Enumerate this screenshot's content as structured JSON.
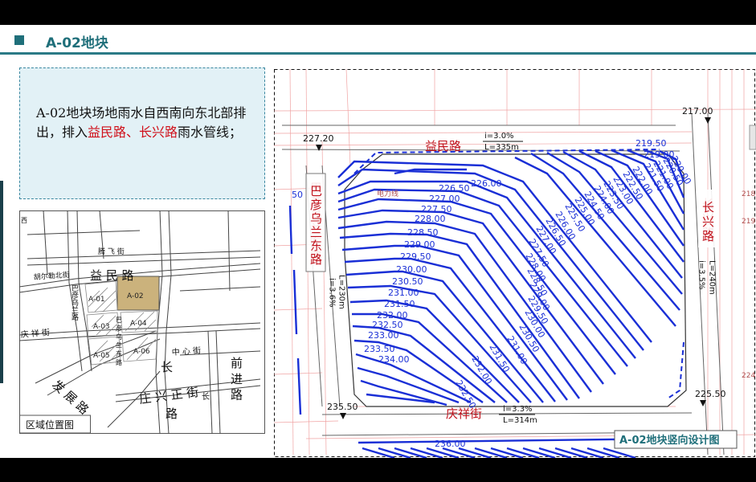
{
  "header": {
    "title": "A-02地块"
  },
  "description": {
    "part1": "A-02地块场地雨水自西南向东北部排出，排入",
    "highlight": "益民路、长兴路",
    "part2": "雨水管线；"
  },
  "location_map": {
    "caption": "区域位置图",
    "roads": {
      "yimin": "益 民 路",
      "qingxiang": "庆 祥 街",
      "hutuqi": "胡尔勒北街",
      "fazhan": "发 展 路",
      "zhuangxing": "庄 兴 正 街",
      "zhongxin": "中 心 街",
      "chang": "长",
      "qianjin": "前 进 路",
      "tengfei": "腾 飞 街",
      "bayan": "巴 彦 乌 兰 东 路",
      "bayan_short": "巴彦乌兰路",
      "xi": "西",
      "chang2": "长",
      "xing": "兴",
      "lu": "路"
    },
    "parcels": [
      "A-01",
      "A-02",
      "A-03",
      "A-04",
      "A-05",
      "A-06"
    ]
  },
  "main_map": {
    "badge": "A-02地块竖向设计图",
    "roads": {
      "top": "益民路",
      "bottom": "庆祥街",
      "left": "巴彦乌兰东路",
      "right": "长兴路"
    },
    "road_specs": {
      "top_i": "i=3.0%",
      "top_l": "L=335m",
      "bottom_i": "i=3.3%",
      "bottom_l": "L=314m",
      "left_i": "i=3.6%",
      "left_l": "L=230m",
      "right_i": "i=3.5%",
      "right_l": "L=240m"
    },
    "corner_elevations": {
      "nw": "227.20",
      "ne": "217.00",
      "sw": "235.50",
      "se": "225.50"
    },
    "misc": {
      "power": "电力线",
      "side_left": "50",
      "side_right1": "218",
      "side_right2": "219",
      "side_right3": "224",
      "bottom_contour": "236.00"
    },
    "contours_left": [
      "226.00",
      "226.50",
      "227.00",
      "227.50",
      "228.00",
      "228.50",
      "229.00",
      "229.50",
      "230.00",
      "230.50",
      "231.00",
      "231.50",
      "232.00",
      "232.50",
      "233.00",
      "233.50",
      "234.00"
    ],
    "contours_diag": [
      "232.50",
      "232.00",
      "231.50",
      "231.00",
      "230.50",
      "230.00",
      "229.50",
      "229.00",
      "228.50",
      "228.00",
      "227.50",
      "227.00",
      "226.50",
      "226.00",
      "225.50",
      "225.00",
      "224.50",
      "224.00",
      "223.50",
      "223.00",
      "222.50",
      "222.00",
      "221.50",
      "221.00",
      "220.50",
      "220.00",
      "219.50",
      "219.00"
    ]
  },
  "colors": {
    "accent": "#1f6f7a",
    "contour": "#1a2fd6",
    "road_label": "#c0101a",
    "panel_bg": "#e2f1f6"
  }
}
